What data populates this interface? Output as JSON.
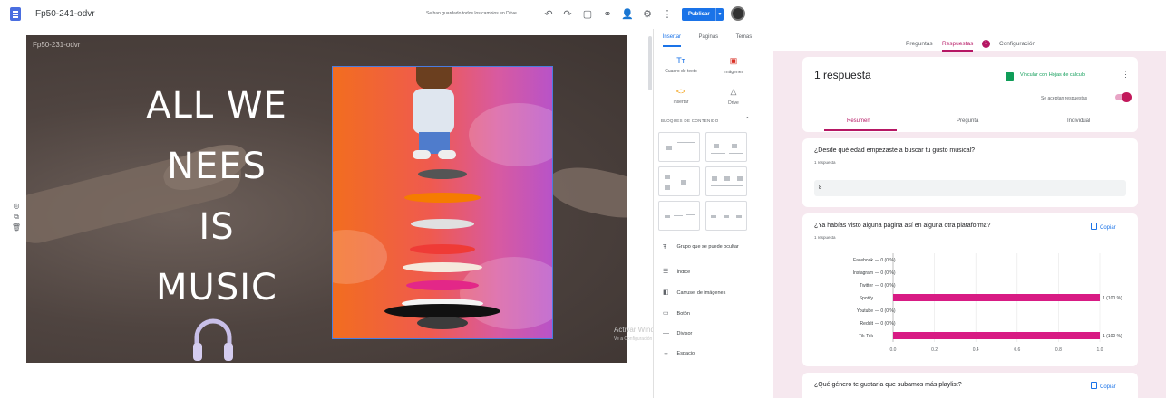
{
  "sites": {
    "doc_title": "Fp50-241-odvr",
    "save_status": "Se han guardado todos los cambios en Drive",
    "publish_label": "Publicar",
    "canvas_name": "Fp50-231-odvr",
    "hero_lines": [
      "ALL WE",
      "NEES",
      "IS",
      "MUSIC"
    ],
    "image_dots": "• • • • • • •",
    "watermark_title": "Activar Windows",
    "watermark_sub": "Ve a Configuración para activar Windows.",
    "panel": {
      "tabs": [
        "Insertar",
        "Páginas",
        "Temas"
      ],
      "active_tab": "Insertar",
      "tools": [
        {
          "label": "Cuadro de texto",
          "icon": "text-box-icon",
          "glyph": "Tт"
        },
        {
          "label": "Imágenes",
          "icon": "image-icon",
          "glyph": "▣"
        },
        {
          "label": "Insertar",
          "icon": "embed-icon",
          "glyph": "<>"
        },
        {
          "label": "Drive",
          "icon": "drive-icon",
          "glyph": "△"
        }
      ],
      "blocks_title": "BLOQUES DE CONTENIDO",
      "list": [
        {
          "label": "Grupo que se puede ocultar",
          "icon": "collapsible-icon",
          "glyph": "Ŧ"
        },
        {
          "label": "Índice",
          "icon": "toc-icon",
          "glyph": "☰"
        },
        {
          "label": "Carrusel de imágenes",
          "icon": "carousel-icon",
          "glyph": "◧"
        },
        {
          "label": "Botón",
          "icon": "button-icon",
          "glyph": "▭"
        },
        {
          "label": "Divisor",
          "icon": "divider-icon",
          "glyph": "—"
        },
        {
          "label": "Espacio",
          "icon": "spacer-icon",
          "glyph": "↔"
        }
      ]
    },
    "colors": {
      "accent": "#1a73e8"
    }
  },
  "forms": {
    "tabs": [
      {
        "label": "Preguntas",
        "active": false
      },
      {
        "label": "Respuestas",
        "active": true
      },
      {
        "label": "Configuración",
        "active": false
      }
    ],
    "badge": "1",
    "responses_count": "1 respuesta",
    "sheets_link": "Vincular con Hojas de cálculo",
    "accepting_label": "Se aceptan respuestas",
    "accepting": true,
    "subtabs": [
      "Resumen",
      "Pregunta",
      "Individual"
    ],
    "active_subtab": "Resumen",
    "q1": {
      "title": "¿Desde qué edad empezaste a buscar tu gusto musical?",
      "sub": "1 respuesta",
      "answer": "8"
    },
    "q2": {
      "title": "¿Ya habías visto alguna página así en alguna otra plataforma?",
      "sub": "1 respuesta",
      "copy_label": "Copiar"
    },
    "q3": {
      "title": "¿Qué género te gustaría que subamos más playlist?",
      "copy_label": "Copiar"
    },
    "colors": {
      "accent": "#b61764",
      "bar": "#d81b84",
      "sheets": "#0f9d58"
    }
  },
  "chart_data": {
    "type": "bar",
    "orientation": "horizontal",
    "categories": [
      "Facebook",
      "Instagram",
      "Twitter",
      "Spotify",
      "Youtube",
      "Reddit",
      "Tik-Tok"
    ],
    "values": [
      0,
      0,
      0,
      1,
      0,
      0,
      1
    ],
    "value_labels": [
      "0 (0 %)",
      "0 (0 %)",
      "0 (0 %)",
      "1 (100 %)",
      "0 (0 %)",
      "0 (0 %)",
      "1 (100 %)"
    ],
    "xticks": [
      "0.0",
      "0.2",
      "0.4",
      "0.6",
      "0.8",
      "1.0"
    ],
    "xlim": [
      0,
      1
    ],
    "grid": true
  }
}
